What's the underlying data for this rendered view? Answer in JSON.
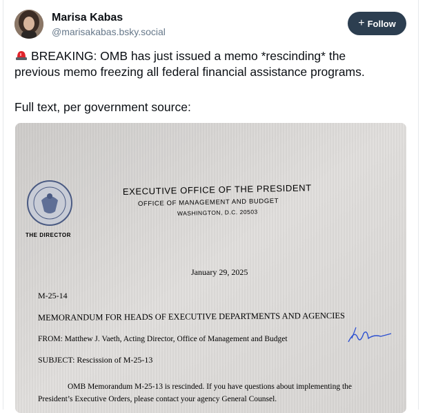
{
  "author": {
    "name": "Marisa Kabas",
    "handle": "@marisakabas.bsky.social"
  },
  "follow_label": "Follow",
  "post": {
    "line1": "BREAKING: OMB has just issued a memo *rescinding* the",
    "line2": "previous memo freezing all federal financial assistance programs.",
    "line3": "Full text, per government source:"
  },
  "memo": {
    "header1": "EXECUTIVE OFFICE OF THE PRESIDENT",
    "header2": "OFFICE OF MANAGEMENT AND BUDGET",
    "header3": "WASHINGTON, D.C. 20503",
    "director": "THE DIRECTOR",
    "date": "January 29, 2025",
    "number": "M-25-14",
    "to": "MEMORANDUM FOR HEADS OF EXECUTIVE DEPARTMENTS AND AGENCIES",
    "from": "FROM: Matthew J. Vaeth, Acting Director, Office of Management and Budget",
    "subject": "SUBJECT: Rescission of M-25-13",
    "body1": "OMB Memorandum M-25-13 is rescinded.  If you have questions about implementing the",
    "body2": "President’s Executive Orders, please contact your agency General Counsel."
  },
  "colors": {
    "follow_bg": "#2c3e50",
    "handle": "#66788a",
    "paper": "#d6d4d2"
  },
  "icons": [
    "siren-icon",
    "plus-icon",
    "omb-seal-icon",
    "signature-mark"
  ]
}
